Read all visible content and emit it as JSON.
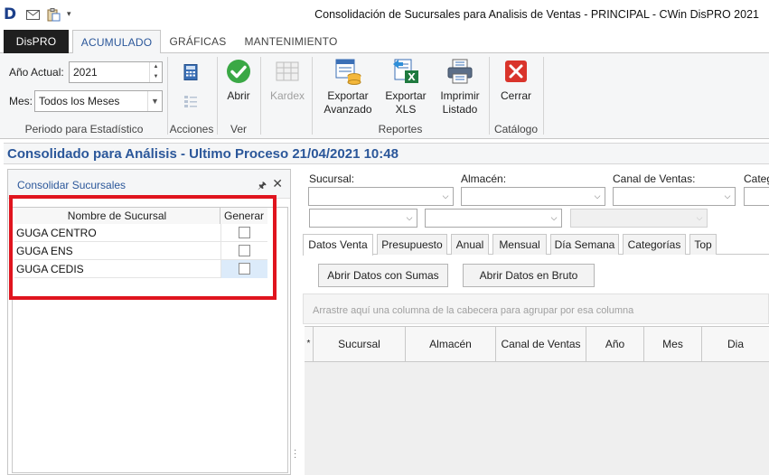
{
  "titlebar": {
    "title": "Consolidación de Sucursales para Analisis de Ventas - PRINCIPAL - CWin DisPRO 2021",
    "logo_letter": "D",
    "icons": [
      "app-logo-icon",
      "mail-icon",
      "clipboard-icon",
      "quick-access-dropdown-icon"
    ]
  },
  "ribbon_tabs": [
    {
      "label": "DisPRO"
    },
    {
      "label": "ACUMULADO"
    },
    {
      "label": "GRÁFICAS"
    },
    {
      "label": "MANTENIMIENTO"
    }
  ],
  "ribbon": {
    "periodo": {
      "year_label": "Año Actual:",
      "year_value": "2021",
      "month_label": "Mes:",
      "month_value": "Todos los Meses",
      "group_label": "Periodo para Estadístico"
    },
    "acciones": {
      "group_label": "Acciones",
      "icons": [
        "calculator-icon",
        "list-icon"
      ]
    },
    "ver": {
      "group_label": "Ver",
      "abrir_label": "Abrir"
    },
    "reportes": {
      "group_label": "Reportes",
      "kardex_label": "Kardex",
      "exportar_avanzado_label": "Exportar\nAvanzado",
      "exportar_avanzado_l1": "Exportar",
      "exportar_avanzado_l2": "Avanzado",
      "exportar_xls_l1": "Exportar",
      "exportar_xls_l2": "XLS",
      "imprimir_l1": "Imprimir",
      "imprimir_l2": "Listado"
    },
    "catalogo": {
      "group_label": "Catálogo",
      "cerrar_label": "Cerrar"
    }
  },
  "header": {
    "title": "Consolidado para Análisis - Ultimo Proceso 21/04/2021 10:48"
  },
  "left_panel": {
    "title": "Consolidar Sucursales",
    "pin_glyph": "🖈",
    "close_glyph": "✕",
    "columns": [
      "Nombre de Sucursal",
      "Generar"
    ],
    "rows": [
      {
        "name": "GUGA CENTRO",
        "generar": false
      },
      {
        "name": "GUGA ENS",
        "generar": false
      },
      {
        "name": "GUGA CEDIS",
        "generar": false
      }
    ]
  },
  "filters": {
    "sucursal_label": "Sucursal:",
    "almacen_label": "Almacén:",
    "canal_label": "Canal de Ventas:",
    "categoria_label": "Categ"
  },
  "inner_tabs": [
    "Datos Venta",
    "Presupuesto",
    "Anual",
    "Mensual",
    "Día Semana",
    "Categorías",
    "Top"
  ],
  "buttons": {
    "abrir_sumas": "Abrir Datos con Sumas",
    "abrir_bruto": "Abrir Datos en Bruto"
  },
  "group_zone_text": "Arrastre aquí una columna de la cabecera para agrupar por esa columna",
  "grid_columns": [
    "*",
    "Sucursal",
    "Almacén",
    "Canal de Ventas",
    "Año",
    "Mes",
    "Dia"
  ],
  "colors": {
    "accent_blue": "#2b579a",
    "highlight_red": "#e0141e",
    "app_tab": "#1f1f1f"
  }
}
